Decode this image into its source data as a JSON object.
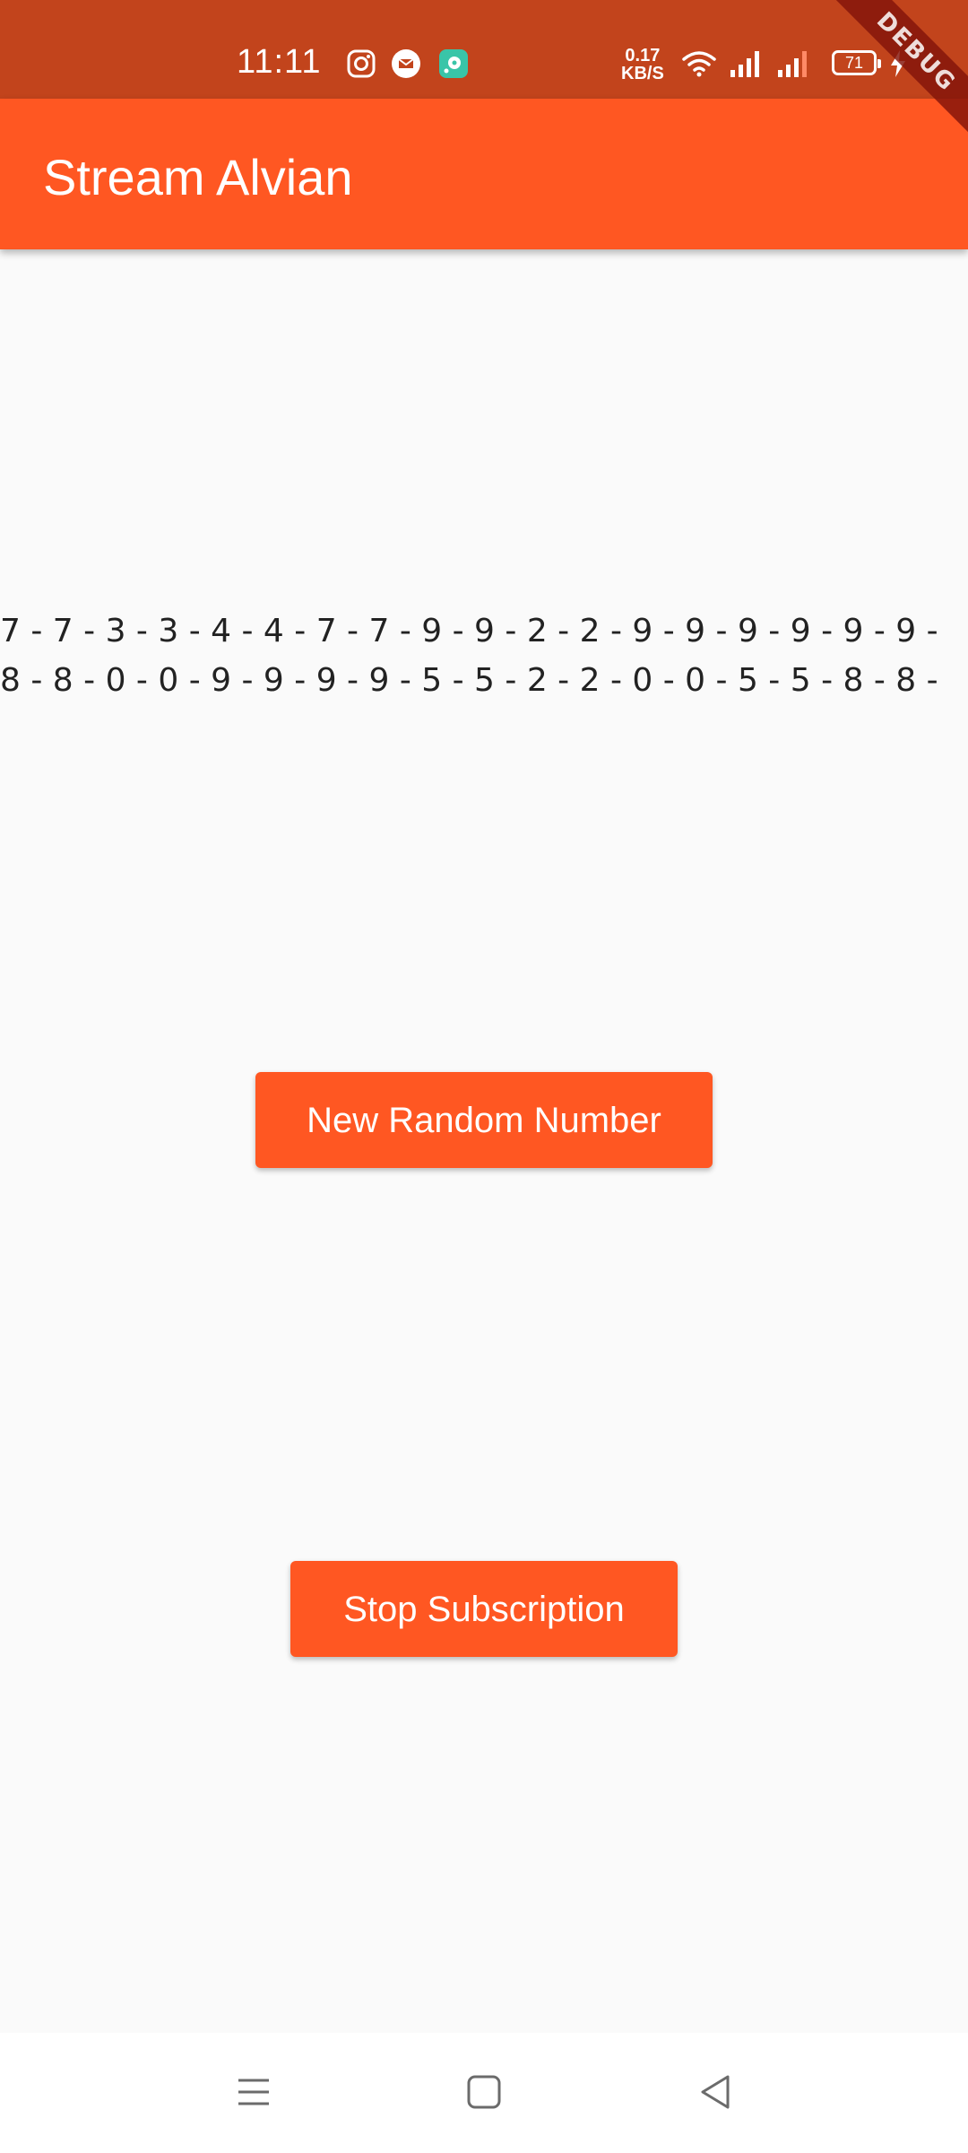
{
  "status_bar": {
    "time": "11:11",
    "net_speed_value": "0.17",
    "net_speed_unit": "KB/S",
    "battery": "71",
    "icons": [
      "instagram-icon",
      "message-icon",
      "app-icon",
      "wifi-icon",
      "signal-icon",
      "signal-icon",
      "battery-icon",
      "charging-icon"
    ]
  },
  "debug_banner": "DEBUG",
  "app_bar": {
    "title": "Stream Alvian"
  },
  "main": {
    "number_stream": "7 - 7 - 3 - 3 - 4 - 4 - 7 - 7 - 9 - 9 - 2 - 2 - 9 - 9 - 9 - 9 - 9 - 9 - 8 - 8 - 0 - 0 - 9 - 9 - 9 - 9 - 5 - 5 - 2 - 2 - 0 - 0 - 5 - 5 - 8 - 8 -",
    "new_random_button": "New Random Number",
    "stop_subscription_button": "Stop Subscription"
  },
  "nav_bar": {
    "icons": [
      "menu-icon",
      "home-icon",
      "back-icon"
    ]
  },
  "colors": {
    "status_bar": "#c2441c",
    "primary": "#ff5722",
    "background": "#fafafa",
    "text": "#222222"
  }
}
